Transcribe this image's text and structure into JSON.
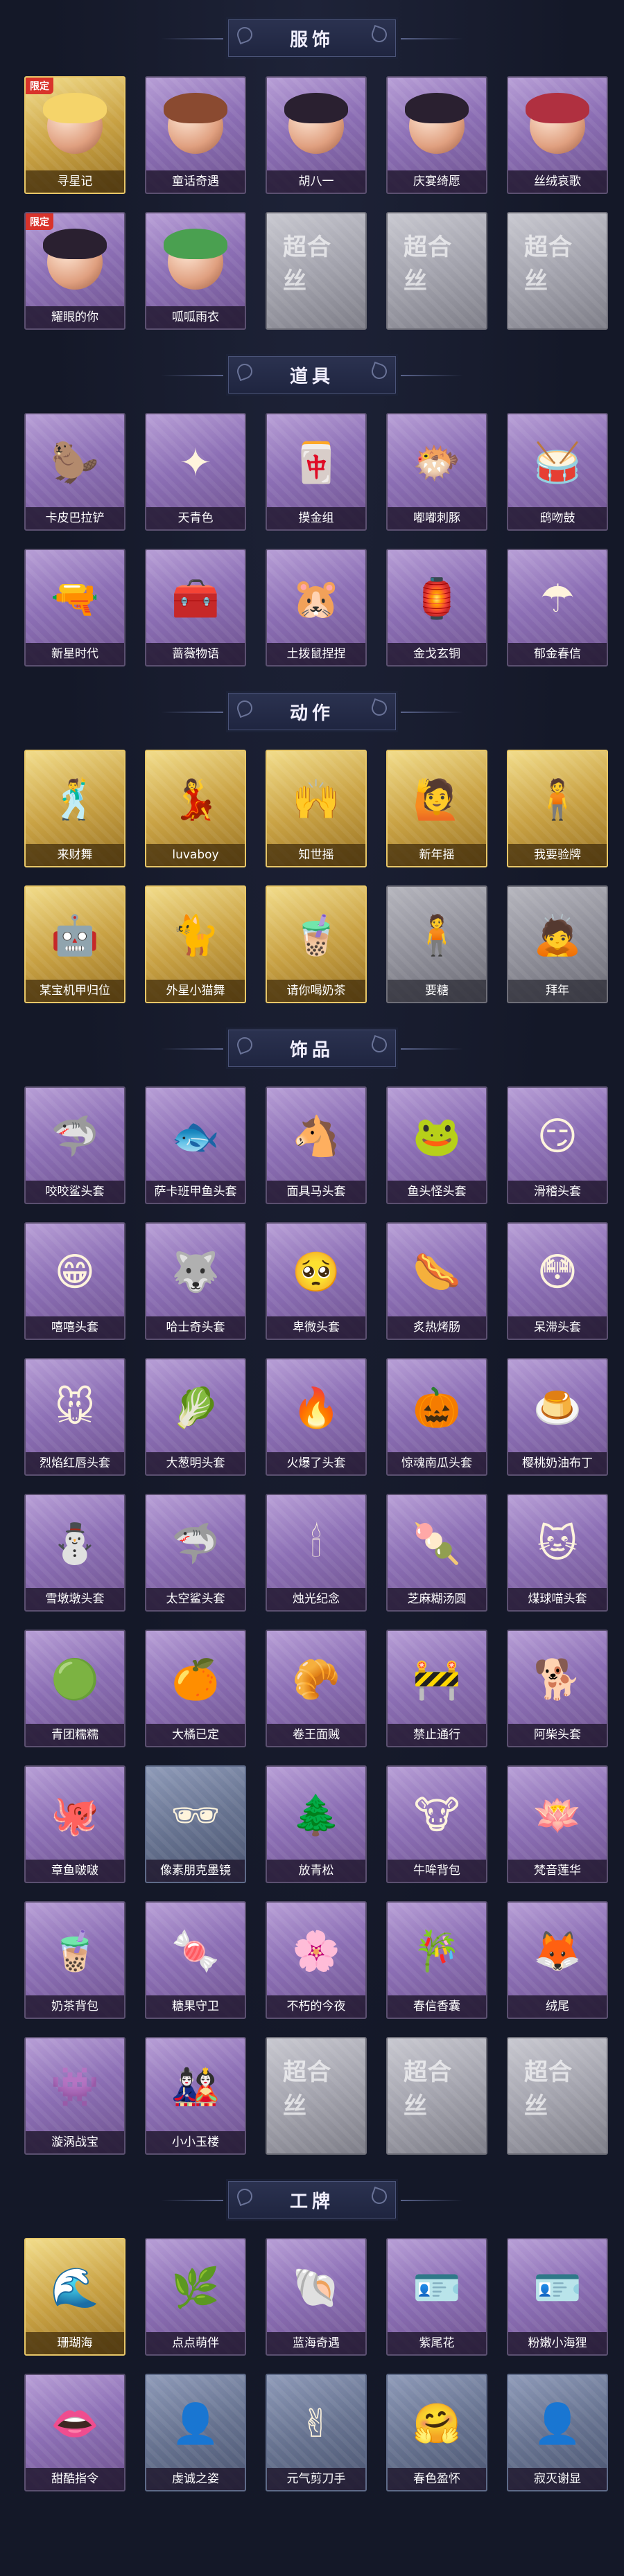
{
  "sections": [
    {
      "title": "服饰",
      "items": [
        {
          "label": "寻星记",
          "style": "gold",
          "badge": "限定",
          "icon": "blonde-character-icon",
          "art": "hair-blond"
        },
        {
          "label": "童话奇遇",
          "style": "purple",
          "icon": "fairy-tale-character-icon",
          "art": "hair-brown"
        },
        {
          "label": "胡八一",
          "style": "purple",
          "icon": "explorer-character-icon",
          "art": "hair-black"
        },
        {
          "label": "庆宴绮愿",
          "style": "purple",
          "icon": "banquet-character-icon",
          "art": "hair-black"
        },
        {
          "label": "丝绒哀歌",
          "style": "purple",
          "icon": "velvet-character-icon",
          "art": "hair-red"
        },
        {
          "label": "耀眼的你",
          "style": "purple",
          "badge": "限定",
          "icon": "cowboy-hat-character-icon",
          "art": "hair-black"
        },
        {
          "label": "呱呱雨衣",
          "style": "purple",
          "icon": "frog-raincoat-character-icon",
          "art": "hair-green"
        },
        {
          "label": "",
          "style": "empty",
          "mark": "超合丝",
          "icon": "locked-slot-icon"
        },
        {
          "label": "",
          "style": "empty",
          "mark": "超合丝",
          "icon": "locked-slot-icon"
        },
        {
          "label": "",
          "style": "empty",
          "mark": "超合丝",
          "icon": "locked-slot-icon"
        }
      ]
    },
    {
      "title": "道具",
      "items": [
        {
          "label": "卡皮巴拉铲",
          "style": "purple",
          "icon": "capybara-shovel-icon",
          "glyph": "🦫"
        },
        {
          "label": "天青色",
          "style": "purple",
          "icon": "blue-wand-icon",
          "glyph": "✦"
        },
        {
          "label": "摸金组",
          "style": "purple",
          "icon": "gold-tile-icon",
          "glyph": "🀄"
        },
        {
          "label": "嘟嘟刺豚",
          "style": "purple",
          "icon": "pufferfish-icon",
          "glyph": "🐡"
        },
        {
          "label": "鸱吻鼓",
          "style": "purple",
          "icon": "drum-icon",
          "glyph": "🥁"
        },
        {
          "label": "新星时代",
          "style": "purple",
          "icon": "revolver-icon",
          "glyph": "🔫"
        },
        {
          "label": "蔷薇物语",
          "style": "purple",
          "icon": "medical-case-icon",
          "glyph": "🧰"
        },
        {
          "label": "土拨鼠捏捏",
          "style": "purple",
          "icon": "groundhog-icon",
          "glyph": "🐹"
        },
        {
          "label": "金戈玄铜",
          "style": "purple",
          "icon": "bronze-lantern-icon",
          "glyph": "🏮"
        },
        {
          "label": "郁金春信",
          "style": "purple",
          "icon": "paper-umbrella-icon",
          "glyph": "☂"
        }
      ]
    },
    {
      "title": "动作",
      "items": [
        {
          "label": "来财舞",
          "style": "gold",
          "icon": "dance-pose-icon",
          "glyph": "🕺"
        },
        {
          "label": "luvaboy",
          "style": "gold",
          "icon": "heart-pose-icon",
          "glyph": "💃"
        },
        {
          "label": "知世摇",
          "style": "gold",
          "icon": "sway-pose-icon",
          "glyph": "🙌"
        },
        {
          "label": "新年摇",
          "style": "gold",
          "icon": "new-year-pose-icon",
          "glyph": "🙋"
        },
        {
          "label": "我要验牌",
          "style": "gold",
          "icon": "card-check-pose-icon",
          "glyph": "🧍"
        },
        {
          "label": "某宝机甲归位",
          "style": "gold",
          "icon": "mecha-pose-icon",
          "glyph": "🤖"
        },
        {
          "label": "外星小猫舞",
          "style": "gold",
          "icon": "alien-cat-pose-icon",
          "glyph": "🐈"
        },
        {
          "label": "请你喝奶茶",
          "style": "gold",
          "icon": "milk-tea-pose-icon",
          "glyph": "🧋"
        },
        {
          "label": "要糖",
          "style": "gray",
          "icon": "candy-pose-icon",
          "glyph": "🧍"
        },
        {
          "label": "拜年",
          "style": "gray",
          "icon": "greeting-pose-icon",
          "glyph": "🙇"
        }
      ]
    },
    {
      "title": "饰品",
      "items": [
        {
          "label": "咬咬鲨头套",
          "style": "purple",
          "icon": "shark-head-icon",
          "glyph": "🦈"
        },
        {
          "label": "萨卡班甲鱼头套",
          "style": "purple",
          "icon": "fish-head-icon",
          "glyph": "🐟"
        },
        {
          "label": "面具马头套",
          "style": "purple",
          "icon": "horse-head-icon",
          "glyph": "🐴"
        },
        {
          "label": "鱼头怪头套",
          "style": "purple",
          "icon": "fish-monster-head-icon",
          "glyph": "🐸"
        },
        {
          "label": "滑稽头套",
          "style": "purple",
          "icon": "smirk-head-icon",
          "glyph": "😏"
        },
        {
          "label": "嘻嘻头套",
          "style": "purple",
          "icon": "grin-head-icon",
          "glyph": "😁"
        },
        {
          "label": "哈士奇头套",
          "style": "purple",
          "icon": "husky-head-icon",
          "glyph": "🐺"
        },
        {
          "label": "卑微头套",
          "style": "purple",
          "icon": "humble-head-icon",
          "glyph": "🥺"
        },
        {
          "label": "炙热烤肠",
          "style": "purple",
          "icon": "sausage-head-icon",
          "glyph": "🌭"
        },
        {
          "label": "呆滞头套",
          "style": "purple",
          "icon": "dazed-head-icon",
          "glyph": "😳"
        },
        {
          "label": "烈焰红唇头套",
          "style": "purple",
          "icon": "red-lips-head-icon",
          "glyph": "🐭"
        },
        {
          "label": "大葱明头套",
          "style": "purple",
          "icon": "scallion-head-icon",
          "glyph": "🥬"
        },
        {
          "label": "火爆了头套",
          "style": "purple",
          "icon": "fire-head-icon",
          "glyph": "🔥"
        },
        {
          "label": "惊魂南瓜头套",
          "style": "purple",
          "icon": "pumpkin-head-icon",
          "glyph": "🎃"
        },
        {
          "label": "樱桃奶油布丁",
          "style": "purple",
          "icon": "pudding-head-icon",
          "glyph": "🍮"
        },
        {
          "label": "雪墩墩头套",
          "style": "purple",
          "icon": "snowman-head-icon",
          "glyph": "⛄"
        },
        {
          "label": "太空鲨头套",
          "style": "purple",
          "icon": "space-shark-head-icon",
          "glyph": "🦈"
        },
        {
          "label": "烛光纪念",
          "style": "purple",
          "icon": "candle-head-icon",
          "glyph": "🕯"
        },
        {
          "label": "芝麻糊汤圆",
          "style": "purple",
          "icon": "dumpling-head-icon",
          "glyph": "🍡"
        },
        {
          "label": "煤球喵头套",
          "style": "purple",
          "icon": "black-cat-head-icon",
          "glyph": "🐱"
        },
        {
          "label": "青团糯糯",
          "style": "purple",
          "icon": "green-rice-ball-icon",
          "glyph": "🟢"
        },
        {
          "label": "大橘已定",
          "style": "purple",
          "icon": "orange-head-icon",
          "glyph": "🍊"
        },
        {
          "label": "卷王面贼",
          "style": "purple",
          "icon": "bread-roll-icon",
          "glyph": "🥐"
        },
        {
          "label": "禁止通行",
          "style": "purple",
          "icon": "road-sign-icon",
          "glyph": "🚧"
        },
        {
          "label": "阿柴头套",
          "style": "purple",
          "icon": "shiba-head-icon",
          "glyph": "🐕"
        },
        {
          "label": "章鱼啵啵",
          "style": "purple",
          "icon": "octopus-head-icon",
          "glyph": "🐙"
        },
        {
          "label": "像素朋克墨镜",
          "style": "steel",
          "icon": "pixel-sunglasses-icon",
          "glyph": "🕶"
        },
        {
          "label": "放青松",
          "style": "purple",
          "icon": "bonsai-pine-icon",
          "glyph": "🌲"
        },
        {
          "label": "牛哞背包",
          "style": "purple",
          "icon": "cow-backpack-icon",
          "glyph": "🐮"
        },
        {
          "label": "梵音莲华",
          "style": "purple",
          "icon": "lotus-icon",
          "glyph": "🪷"
        },
        {
          "label": "奶茶背包",
          "style": "purple",
          "icon": "milk-tea-backpack-icon",
          "glyph": "🧋"
        },
        {
          "label": "糖果守卫",
          "style": "purple",
          "icon": "candy-guard-icon",
          "glyph": "🍬"
        },
        {
          "label": "不朽的今夜",
          "style": "purple",
          "icon": "eternal-night-icon",
          "glyph": "🌸"
        },
        {
          "label": "春信香囊",
          "style": "purple",
          "icon": "sachet-icon",
          "glyph": "🎋"
        },
        {
          "label": "绒尾",
          "style": "purple",
          "icon": "fluffy-tail-icon",
          "glyph": "🦊"
        },
        {
          "label": "漩涡战宝",
          "style": "purple",
          "icon": "swirl-treasure-icon",
          "glyph": "👾"
        },
        {
          "label": "小小玉楼",
          "style": "purple",
          "icon": "mini-doll-icon",
          "glyph": "🎎"
        },
        {
          "label": "",
          "style": "empty",
          "mark": "超合丝",
          "icon": "locked-slot-icon"
        },
        {
          "label": "",
          "style": "empty",
          "mark": "超合丝",
          "icon": "locked-slot-icon"
        },
        {
          "label": "",
          "style": "empty",
          "mark": "超合丝",
          "icon": "locked-slot-icon"
        }
      ]
    },
    {
      "title": "工牌",
      "items": [
        {
          "label": "珊瑚海",
          "style": "gold",
          "icon": "coral-sea-badge-icon",
          "glyph": "🌊"
        },
        {
          "label": "点点萌伴",
          "style": "purple",
          "icon": "green-field-badge-icon",
          "glyph": "🌿"
        },
        {
          "label": "蓝海奇遇",
          "style": "purple",
          "icon": "blue-sea-badge-icon",
          "glyph": "🐚"
        },
        {
          "label": "紫尾花",
          "style": "purple",
          "icon": "purple-frame-badge-icon",
          "glyph": "🪪"
        },
        {
          "label": "粉嫩小海狸",
          "style": "purple",
          "icon": "pink-frame-badge-icon",
          "glyph": "🪪"
        },
        {
          "label": "甜酷指令",
          "style": "purple",
          "icon": "pink-monster-badge-icon",
          "glyph": "👄"
        },
        {
          "label": "虔诚之姿",
          "style": "steel",
          "icon": "portrait-badge-icon",
          "glyph": "👤"
        },
        {
          "label": "元气剪刀手",
          "style": "steel",
          "icon": "peace-sign-badge-icon",
          "glyph": "✌"
        },
        {
          "label": "春色盈怀",
          "style": "steel",
          "icon": "hug-badge-icon",
          "glyph": "🤗"
        },
        {
          "label": "寂灭谢显",
          "style": "steel",
          "icon": "silhouette-badge-icon",
          "glyph": "👤"
        }
      ]
    }
  ]
}
